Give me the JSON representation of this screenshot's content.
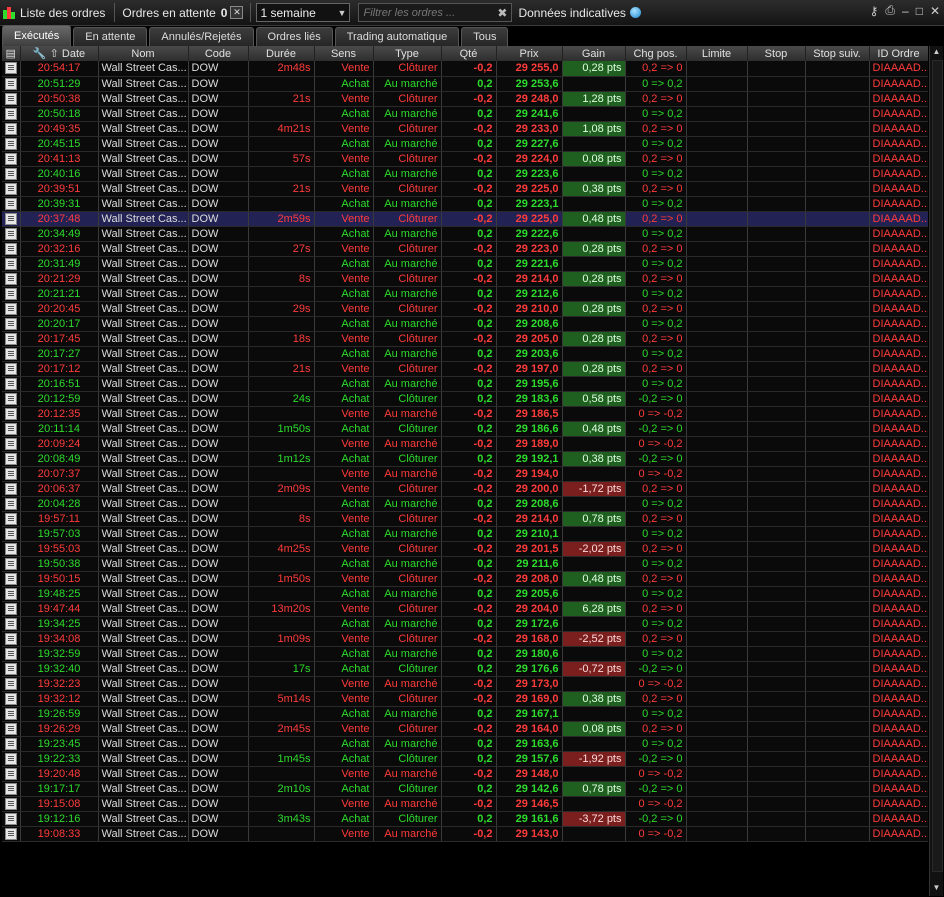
{
  "toolbar": {
    "title": "Liste des ordres",
    "pending_label": "Ordres en attente",
    "pending_count": "0",
    "period": "1 semaine",
    "filter_placeholder": "Filtrer les ordres ...",
    "data_label": "Données indicatives",
    "icons": [
      "candlestick-icon",
      "key-icon",
      "printer-icon",
      "minimize-icon",
      "maximize-icon",
      "close-icon"
    ]
  },
  "tabs": [
    {
      "label": "Exécutés",
      "active": true
    },
    {
      "label": "En attente",
      "active": false
    },
    {
      "label": "Annulés/Rejetés",
      "active": false
    },
    {
      "label": "Ordres liés",
      "active": false
    },
    {
      "label": "Trading automatique",
      "active": false
    },
    {
      "label": "Tous",
      "active": false
    }
  ],
  "columns": [
    "Date",
    "Nom",
    "Code",
    "Durée",
    "Sens",
    "Type",
    "Qté",
    "Prix",
    "Gain",
    "Chg pos.",
    "Limite",
    "Stop",
    "Stop suiv.",
    "ID Ordre"
  ],
  "colors": {
    "sell": "#ff3b3b",
    "buy": "#2ddc2d",
    "gain_pos_bg": "#1f5f1f",
    "gain_neg_bg": "#7a1e1e",
    "selected_bg": "#222255"
  },
  "rows": [
    {
      "date": "20:54:17",
      "nom": "Wall Street Cas...",
      "code": "DOW",
      "duree": "2m48s",
      "sens": "Vente",
      "type": "Clôturer",
      "qte": "-0,2",
      "prix": "29 255,0",
      "gain": "0,28 pts",
      "chg": "0,2 => 0",
      "limite": "",
      "stop": "",
      "stop_suiv": "",
      "id": "DIAAAAD..."
    },
    {
      "date": "20:51:29",
      "nom": "Wall Street Cas...",
      "code": "DOW",
      "duree": "",
      "sens": "Achat",
      "type": "Au marché",
      "qte": "0,2",
      "prix": "29 253,6",
      "gain": "",
      "chg": "0 => 0,2",
      "limite": "",
      "stop": "",
      "stop_suiv": "",
      "id": "DIAAAAD..."
    },
    {
      "date": "20:50:38",
      "nom": "Wall Street Cas...",
      "code": "DOW",
      "duree": "21s",
      "sens": "Vente",
      "type": "Clôturer",
      "qte": "-0,2",
      "prix": "29 248,0",
      "gain": "1,28 pts",
      "chg": "0,2 => 0",
      "limite": "",
      "stop": "",
      "stop_suiv": "",
      "id": "DIAAAAD..."
    },
    {
      "date": "20:50:18",
      "nom": "Wall Street Cas...",
      "code": "DOW",
      "duree": "",
      "sens": "Achat",
      "type": "Au marché",
      "qte": "0,2",
      "prix": "29 241,6",
      "gain": "",
      "chg": "0 => 0,2",
      "limite": "",
      "stop": "",
      "stop_suiv": "",
      "id": "DIAAAAD..."
    },
    {
      "date": "20:49:35",
      "nom": "Wall Street Cas...",
      "code": "DOW",
      "duree": "4m21s",
      "sens": "Vente",
      "type": "Clôturer",
      "qte": "-0,2",
      "prix": "29 233,0",
      "gain": "1,08 pts",
      "chg": "0,2 => 0",
      "limite": "",
      "stop": "",
      "stop_suiv": "",
      "id": "DIAAAAD..."
    },
    {
      "date": "20:45:15",
      "nom": "Wall Street Cas...",
      "code": "DOW",
      "duree": "",
      "sens": "Achat",
      "type": "Au marché",
      "qte": "0,2",
      "prix": "29 227,6",
      "gain": "",
      "chg": "0 => 0,2",
      "limite": "",
      "stop": "",
      "stop_suiv": "",
      "id": "DIAAAAD..."
    },
    {
      "date": "20:41:13",
      "nom": "Wall Street Cas...",
      "code": "DOW",
      "duree": "57s",
      "sens": "Vente",
      "type": "Clôturer",
      "qte": "-0,2",
      "prix": "29 224,0",
      "gain": "0,08 pts",
      "chg": "0,2 => 0",
      "limite": "",
      "stop": "",
      "stop_suiv": "",
      "id": "DIAAAAD..."
    },
    {
      "date": "20:40:16",
      "nom": "Wall Street Cas...",
      "code": "DOW",
      "duree": "",
      "sens": "Achat",
      "type": "Au marché",
      "qte": "0,2",
      "prix": "29 223,6",
      "gain": "",
      "chg": "0 => 0,2",
      "limite": "",
      "stop": "",
      "stop_suiv": "",
      "id": "DIAAAAD..."
    },
    {
      "date": "20:39:51",
      "nom": "Wall Street Cas...",
      "code": "DOW",
      "duree": "21s",
      "sens": "Vente",
      "type": "Clôturer",
      "qte": "-0,2",
      "prix": "29 225,0",
      "gain": "0,38 pts",
      "chg": "0,2 => 0",
      "limite": "",
      "stop": "",
      "stop_suiv": "",
      "id": "DIAAAAD..."
    },
    {
      "date": "20:39:31",
      "nom": "Wall Street Cas...",
      "code": "DOW",
      "duree": "",
      "sens": "Achat",
      "type": "Au marché",
      "qte": "0,2",
      "prix": "29 223,1",
      "gain": "",
      "chg": "0 => 0,2",
      "limite": "",
      "stop": "",
      "stop_suiv": "",
      "id": "DIAAAAD..."
    },
    {
      "date": "20:37:48",
      "nom": "Wall Street Cas...",
      "code": "DOW",
      "duree": "2m59s",
      "sens": "Vente",
      "type": "Clôturer",
      "qte": "-0,2",
      "prix": "29 225,0",
      "gain": "0,48 pts",
      "chg": "0,2 => 0",
      "limite": "",
      "stop": "",
      "stop_suiv": "",
      "id": "DIAAAAD...",
      "selected": true
    },
    {
      "date": "20:34:49",
      "nom": "Wall Street Cas...",
      "code": "DOW",
      "duree": "",
      "sens": "Achat",
      "type": "Au marché",
      "qte": "0,2",
      "prix": "29 222,6",
      "gain": "",
      "chg": "0 => 0,2",
      "limite": "",
      "stop": "",
      "stop_suiv": "",
      "id": "DIAAAAD..."
    },
    {
      "date": "20:32:16",
      "nom": "Wall Street Cas...",
      "code": "DOW",
      "duree": "27s",
      "sens": "Vente",
      "type": "Clôturer",
      "qte": "-0,2",
      "prix": "29 223,0",
      "gain": "0,28 pts",
      "chg": "0,2 => 0",
      "limite": "",
      "stop": "",
      "stop_suiv": "",
      "id": "DIAAAAD..."
    },
    {
      "date": "20:31:49",
      "nom": "Wall Street Cas...",
      "code": "DOW",
      "duree": "",
      "sens": "Achat",
      "type": "Au marché",
      "qte": "0,2",
      "prix": "29 221,6",
      "gain": "",
      "chg": "0 => 0,2",
      "limite": "",
      "stop": "",
      "stop_suiv": "",
      "id": "DIAAAAD..."
    },
    {
      "date": "20:21:29",
      "nom": "Wall Street Cas...",
      "code": "DOW",
      "duree": "8s",
      "sens": "Vente",
      "type": "Clôturer",
      "qte": "-0,2",
      "prix": "29 214,0",
      "gain": "0,28 pts",
      "chg": "0,2 => 0",
      "limite": "",
      "stop": "",
      "stop_suiv": "",
      "id": "DIAAAAD..."
    },
    {
      "date": "20:21:21",
      "nom": "Wall Street Cas...",
      "code": "DOW",
      "duree": "",
      "sens": "Achat",
      "type": "Au marché",
      "qte": "0,2",
      "prix": "29 212,6",
      "gain": "",
      "chg": "0 => 0,2",
      "limite": "",
      "stop": "",
      "stop_suiv": "",
      "id": "DIAAAAD..."
    },
    {
      "date": "20:20:45",
      "nom": "Wall Street Cas...",
      "code": "DOW",
      "duree": "29s",
      "sens": "Vente",
      "type": "Clôturer",
      "qte": "-0,2",
      "prix": "29 210,0",
      "gain": "0,28 pts",
      "chg": "0,2 => 0",
      "limite": "",
      "stop": "",
      "stop_suiv": "",
      "id": "DIAAAAD..."
    },
    {
      "date": "20:20:17",
      "nom": "Wall Street Cas...",
      "code": "DOW",
      "duree": "",
      "sens": "Achat",
      "type": "Au marché",
      "qte": "0,2",
      "prix": "29 208,6",
      "gain": "",
      "chg": "0 => 0,2",
      "limite": "",
      "stop": "",
      "stop_suiv": "",
      "id": "DIAAAAD..."
    },
    {
      "date": "20:17:45",
      "nom": "Wall Street Cas...",
      "code": "DOW",
      "duree": "18s",
      "sens": "Vente",
      "type": "Clôturer",
      "qte": "-0,2",
      "prix": "29 205,0",
      "gain": "0,28 pts",
      "chg": "0,2 => 0",
      "limite": "",
      "stop": "",
      "stop_suiv": "",
      "id": "DIAAAAD..."
    },
    {
      "date": "20:17:27",
      "nom": "Wall Street Cas...",
      "code": "DOW",
      "duree": "",
      "sens": "Achat",
      "type": "Au marché",
      "qte": "0,2",
      "prix": "29 203,6",
      "gain": "",
      "chg": "0 => 0,2",
      "limite": "",
      "stop": "",
      "stop_suiv": "",
      "id": "DIAAAAD..."
    },
    {
      "date": "20:17:12",
      "nom": "Wall Street Cas...",
      "code": "DOW",
      "duree": "21s",
      "sens": "Vente",
      "type": "Clôturer",
      "qte": "-0,2",
      "prix": "29 197,0",
      "gain": "0,28 pts",
      "chg": "0,2 => 0",
      "limite": "",
      "stop": "",
      "stop_suiv": "",
      "id": "DIAAAAD..."
    },
    {
      "date": "20:16:51",
      "nom": "Wall Street Cas...",
      "code": "DOW",
      "duree": "",
      "sens": "Achat",
      "type": "Au marché",
      "qte": "0,2",
      "prix": "29 195,6",
      "gain": "",
      "chg": "0 => 0,2",
      "limite": "",
      "stop": "",
      "stop_suiv": "",
      "id": "DIAAAAD..."
    },
    {
      "date": "20:12:59",
      "nom": "Wall Street Cas...",
      "code": "DOW",
      "duree": "24s",
      "sens": "Achat",
      "type": "Clôturer",
      "qte": "0,2",
      "prix": "29 183,6",
      "gain": "0,58 pts",
      "chg": "-0,2 => 0",
      "limite": "",
      "stop": "",
      "stop_suiv": "",
      "id": "DIAAAAD..."
    },
    {
      "date": "20:12:35",
      "nom": "Wall Street Cas...",
      "code": "DOW",
      "duree": "",
      "sens": "Vente",
      "type": "Au marché",
      "qte": "-0,2",
      "prix": "29 186,5",
      "gain": "",
      "chg": "0 => -0,2",
      "limite": "",
      "stop": "",
      "stop_suiv": "",
      "id": "DIAAAAD..."
    },
    {
      "date": "20:11:14",
      "nom": "Wall Street Cas...",
      "code": "DOW",
      "duree": "1m50s",
      "sens": "Achat",
      "type": "Clôturer",
      "qte": "0,2",
      "prix": "29 186,6",
      "gain": "0,48 pts",
      "chg": "-0,2 => 0",
      "limite": "",
      "stop": "",
      "stop_suiv": "",
      "id": "DIAAAAD..."
    },
    {
      "date": "20:09:24",
      "nom": "Wall Street Cas...",
      "code": "DOW",
      "duree": "",
      "sens": "Vente",
      "type": "Au marché",
      "qte": "-0,2",
      "prix": "29 189,0",
      "gain": "",
      "chg": "0 => -0,2",
      "limite": "",
      "stop": "",
      "stop_suiv": "",
      "id": "DIAAAAD..."
    },
    {
      "date": "20:08:49",
      "nom": "Wall Street Cas...",
      "code": "DOW",
      "duree": "1m12s",
      "sens": "Achat",
      "type": "Clôturer",
      "qte": "0,2",
      "prix": "29 192,1",
      "gain": "0,38 pts",
      "chg": "-0,2 => 0",
      "limite": "",
      "stop": "",
      "stop_suiv": "",
      "id": "DIAAAAD..."
    },
    {
      "date": "20:07:37",
      "nom": "Wall Street Cas...",
      "code": "DOW",
      "duree": "",
      "sens": "Vente",
      "type": "Au marché",
      "qte": "-0,2",
      "prix": "29 194,0",
      "gain": "",
      "chg": "0 => -0,2",
      "limite": "",
      "stop": "",
      "stop_suiv": "",
      "id": "DIAAAAD..."
    },
    {
      "date": "20:06:37",
      "nom": "Wall Street Cas...",
      "code": "DOW",
      "duree": "2m09s",
      "sens": "Vente",
      "type": "Clôturer",
      "qte": "-0,2",
      "prix": "29 200,0",
      "gain": "-1,72 pts",
      "chg": "0,2 => 0",
      "limite": "",
      "stop": "",
      "stop_suiv": "",
      "id": "DIAAAAD..."
    },
    {
      "date": "20:04:28",
      "nom": "Wall Street Cas...",
      "code": "DOW",
      "duree": "",
      "sens": "Achat",
      "type": "Au marché",
      "qte": "0,2",
      "prix": "29 208,6",
      "gain": "",
      "chg": "0 => 0,2",
      "limite": "",
      "stop": "",
      "stop_suiv": "",
      "id": "DIAAAAD..."
    },
    {
      "date": "19:57:11",
      "nom": "Wall Street Cas...",
      "code": "DOW",
      "duree": "8s",
      "sens": "Vente",
      "type": "Clôturer",
      "qte": "-0,2",
      "prix": "29 214,0",
      "gain": "0,78 pts",
      "chg": "0,2 => 0",
      "limite": "",
      "stop": "",
      "stop_suiv": "",
      "id": "DIAAAAD..."
    },
    {
      "date": "19:57:03",
      "nom": "Wall Street Cas...",
      "code": "DOW",
      "duree": "",
      "sens": "Achat",
      "type": "Au marché",
      "qte": "0,2",
      "prix": "29 210,1",
      "gain": "",
      "chg": "0 => 0,2",
      "limite": "",
      "stop": "",
      "stop_suiv": "",
      "id": "DIAAAAD..."
    },
    {
      "date": "19:55:03",
      "nom": "Wall Street Cas...",
      "code": "DOW",
      "duree": "4m25s",
      "sens": "Vente",
      "type": "Clôturer",
      "qte": "-0,2",
      "prix": "29 201,5",
      "gain": "-2,02 pts",
      "chg": "0,2 => 0",
      "limite": "",
      "stop": "",
      "stop_suiv": "",
      "id": "DIAAAAD..."
    },
    {
      "date": "19:50:38",
      "nom": "Wall Street Cas...",
      "code": "DOW",
      "duree": "",
      "sens": "Achat",
      "type": "Au marché",
      "qte": "0,2",
      "prix": "29 211,6",
      "gain": "",
      "chg": "0 => 0,2",
      "limite": "",
      "stop": "",
      "stop_suiv": "",
      "id": "DIAAAAD..."
    },
    {
      "date": "19:50:15",
      "nom": "Wall Street Cas...",
      "code": "DOW",
      "duree": "1m50s",
      "sens": "Vente",
      "type": "Clôturer",
      "qte": "-0,2",
      "prix": "29 208,0",
      "gain": "0,48 pts",
      "chg": "0,2 => 0",
      "limite": "",
      "stop": "",
      "stop_suiv": "",
      "id": "DIAAAAD..."
    },
    {
      "date": "19:48:25",
      "nom": "Wall Street Cas...",
      "code": "DOW",
      "duree": "",
      "sens": "Achat",
      "type": "Au marché",
      "qte": "0,2",
      "prix": "29 205,6",
      "gain": "",
      "chg": "0 => 0,2",
      "limite": "",
      "stop": "",
      "stop_suiv": "",
      "id": "DIAAAAD..."
    },
    {
      "date": "19:47:44",
      "nom": "Wall Street Cas...",
      "code": "DOW",
      "duree": "13m20s",
      "sens": "Vente",
      "type": "Clôturer",
      "qte": "-0,2",
      "prix": "29 204,0",
      "gain": "6,28 pts",
      "chg": "0,2 => 0",
      "limite": "",
      "stop": "",
      "stop_suiv": "",
      "id": "DIAAAAD..."
    },
    {
      "date": "19:34:25",
      "nom": "Wall Street Cas...",
      "code": "DOW",
      "duree": "",
      "sens": "Achat",
      "type": "Au marché",
      "qte": "0,2",
      "prix": "29 172,6",
      "gain": "",
      "chg": "0 => 0,2",
      "limite": "",
      "stop": "",
      "stop_suiv": "",
      "id": "DIAAAAD..."
    },
    {
      "date": "19:34:08",
      "nom": "Wall Street Cas...",
      "code": "DOW",
      "duree": "1m09s",
      "sens": "Vente",
      "type": "Clôturer",
      "qte": "-0,2",
      "prix": "29 168,0",
      "gain": "-2,52 pts",
      "chg": "0,2 => 0",
      "limite": "",
      "stop": "",
      "stop_suiv": "",
      "id": "DIAAAAD..."
    },
    {
      "date": "19:32:59",
      "nom": "Wall Street Cas...",
      "code": "DOW",
      "duree": "",
      "sens": "Achat",
      "type": "Au marché",
      "qte": "0,2",
      "prix": "29 180,6",
      "gain": "",
      "chg": "0 => 0,2",
      "limite": "",
      "stop": "",
      "stop_suiv": "",
      "id": "DIAAAAD..."
    },
    {
      "date": "19:32:40",
      "nom": "Wall Street Cas...",
      "code": "DOW",
      "duree": "17s",
      "sens": "Achat",
      "type": "Clôturer",
      "qte": "0,2",
      "prix": "29 176,6",
      "gain": "-0,72 pts",
      "chg": "-0,2 => 0",
      "limite": "",
      "stop": "",
      "stop_suiv": "",
      "id": "DIAAAAD..."
    },
    {
      "date": "19:32:23",
      "nom": "Wall Street Cas...",
      "code": "DOW",
      "duree": "",
      "sens": "Vente",
      "type": "Au marché",
      "qte": "-0,2",
      "prix": "29 173,0",
      "gain": "",
      "chg": "0 => -0,2",
      "limite": "",
      "stop": "",
      "stop_suiv": "",
      "id": "DIAAAAD..."
    },
    {
      "date": "19:32:12",
      "nom": "Wall Street Cas...",
      "code": "DOW",
      "duree": "5m14s",
      "sens": "Vente",
      "type": "Clôturer",
      "qte": "-0,2",
      "prix": "29 169,0",
      "gain": "0,38 pts",
      "chg": "0,2 => 0",
      "limite": "",
      "stop": "",
      "stop_suiv": "",
      "id": "DIAAAAD..."
    },
    {
      "date": "19:26:59",
      "nom": "Wall Street Cas...",
      "code": "DOW",
      "duree": "",
      "sens": "Achat",
      "type": "Au marché",
      "qte": "0,2",
      "prix": "29 167,1",
      "gain": "",
      "chg": "0 => 0,2",
      "limite": "",
      "stop": "",
      "stop_suiv": "",
      "id": "DIAAAAD..."
    },
    {
      "date": "19:26:29",
      "nom": "Wall Street Cas...",
      "code": "DOW",
      "duree": "2m45s",
      "sens": "Vente",
      "type": "Clôturer",
      "qte": "-0,2",
      "prix": "29 164,0",
      "gain": "0,08 pts",
      "chg": "0,2 => 0",
      "limite": "",
      "stop": "",
      "stop_suiv": "",
      "id": "DIAAAAD..."
    },
    {
      "date": "19:23:45",
      "nom": "Wall Street Cas...",
      "code": "DOW",
      "duree": "",
      "sens": "Achat",
      "type": "Au marché",
      "qte": "0,2",
      "prix": "29 163,6",
      "gain": "",
      "chg": "0 => 0,2",
      "limite": "",
      "stop": "",
      "stop_suiv": "",
      "id": "DIAAAAD..."
    },
    {
      "date": "19:22:33",
      "nom": "Wall Street Cas...",
      "code": "DOW",
      "duree": "1m45s",
      "sens": "Achat",
      "type": "Clôturer",
      "qte": "0,2",
      "prix": "29 157,6",
      "gain": "-1,92 pts",
      "chg": "-0,2 => 0",
      "limite": "",
      "stop": "",
      "stop_suiv": "",
      "id": "DIAAAAD..."
    },
    {
      "date": "19:20:48",
      "nom": "Wall Street Cas...",
      "code": "DOW",
      "duree": "",
      "sens": "Vente",
      "type": "Au marché",
      "qte": "-0,2",
      "prix": "29 148,0",
      "gain": "",
      "chg": "0 => -0,2",
      "limite": "",
      "stop": "",
      "stop_suiv": "",
      "id": "DIAAAAD..."
    },
    {
      "date": "19:17:17",
      "nom": "Wall Street Cas...",
      "code": "DOW",
      "duree": "2m10s",
      "sens": "Achat",
      "type": "Clôturer",
      "qte": "0,2",
      "prix": "29 142,6",
      "gain": "0,78 pts",
      "chg": "-0,2 => 0",
      "limite": "",
      "stop": "",
      "stop_suiv": "",
      "id": "DIAAAAD..."
    },
    {
      "date": "19:15:08",
      "nom": "Wall Street Cas...",
      "code": "DOW",
      "duree": "",
      "sens": "Vente",
      "type": "Au marché",
      "qte": "-0,2",
      "prix": "29 146,5",
      "gain": "",
      "chg": "0 => -0,2",
      "limite": "",
      "stop": "",
      "stop_suiv": "",
      "id": "DIAAAAD..."
    },
    {
      "date": "19:12:16",
      "nom": "Wall Street Cas...",
      "code": "DOW",
      "duree": "3m43s",
      "sens": "Achat",
      "type": "Clôturer",
      "qte": "0,2",
      "prix": "29 161,6",
      "gain": "-3,72 pts",
      "chg": "-0,2 => 0",
      "limite": "",
      "stop": "",
      "stop_suiv": "",
      "id": "DIAAAAD..."
    },
    {
      "date": "19:08:33",
      "nom": "Wall Street Cas...",
      "code": "DOW",
      "duree": "",
      "sens": "Vente",
      "type": "Au marché",
      "qte": "-0,2",
      "prix": "29 143,0",
      "gain": "",
      "chg": "0 => -0,2",
      "limite": "",
      "stop": "",
      "stop_suiv": "",
      "id": "DIAAAAD..."
    }
  ]
}
